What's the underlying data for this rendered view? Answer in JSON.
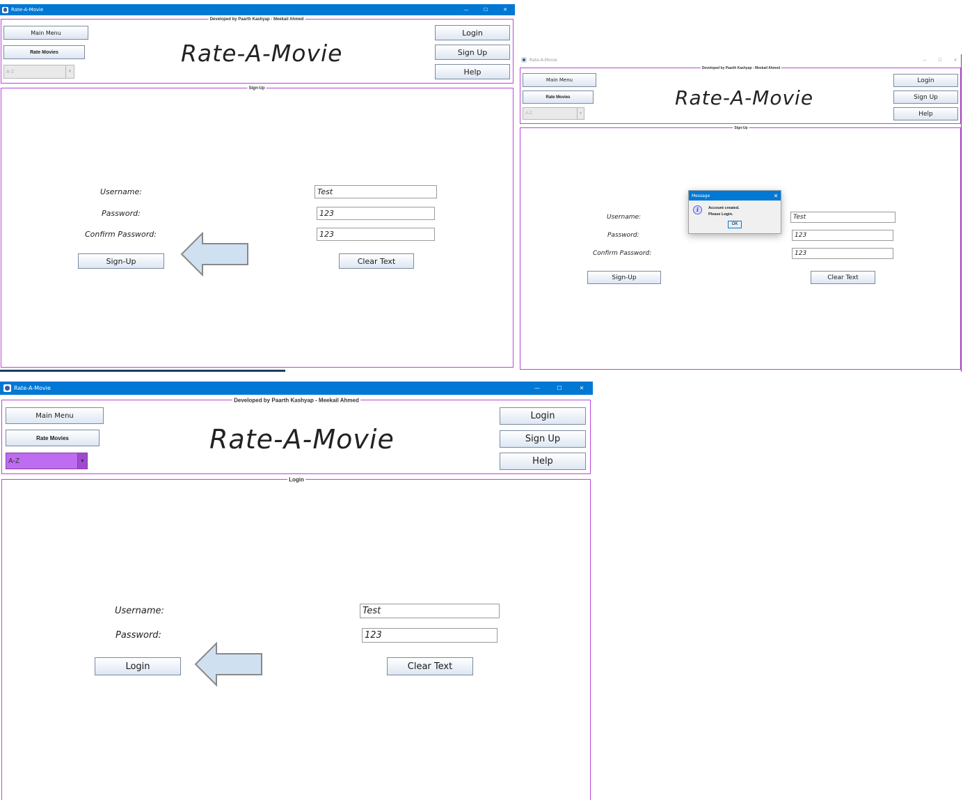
{
  "app": {
    "window_title": "Rate-A-Movie",
    "app_title": "Rate-A-Movie",
    "developer_legend": "Developed by Paarth Kashyap - Meekail Ahmed",
    "window_controls": {
      "minimize": "—",
      "maximize": "☐",
      "close": "✕"
    }
  },
  "nav": {
    "main_menu": "Main Menu",
    "rate_movies": "Rate Movies",
    "sort_value": "A-Z",
    "combo_arrow": "▼",
    "login": "Login",
    "sign_up": "Sign Up",
    "help": "Help"
  },
  "signup_view": {
    "panel_legend": "Sign-Up",
    "username_label": "Username:",
    "password_label": "Password:",
    "confirm_label": "Confirm Password:",
    "username_value": "Test",
    "password_value": "123",
    "confirm_value": "123",
    "submit_button": "Sign-Up",
    "clear_button": "Clear Text"
  },
  "dialog": {
    "title": "Message",
    "close": "✕",
    "icon": "i",
    "line1": "Account created.",
    "line2": "Please Login.",
    "ok": "OK"
  },
  "login_view": {
    "panel_legend": "Login",
    "username_label": "Username:",
    "password_label": "Password:",
    "username_value": "Test",
    "password_value": "123",
    "submit_button": "Login",
    "clear_button": "Clear Text"
  },
  "colors": {
    "titlebar": "#0078d4",
    "panel_border": "#b845d8",
    "combo_active": "#be6cf0",
    "arrow_fill": "#cfe0f1"
  },
  "icons": [
    "app-icon",
    "left-arrow-icon",
    "info-icon",
    "close-icon",
    "minimize-icon",
    "maximize-icon",
    "dropdown-arrow-icon"
  ]
}
